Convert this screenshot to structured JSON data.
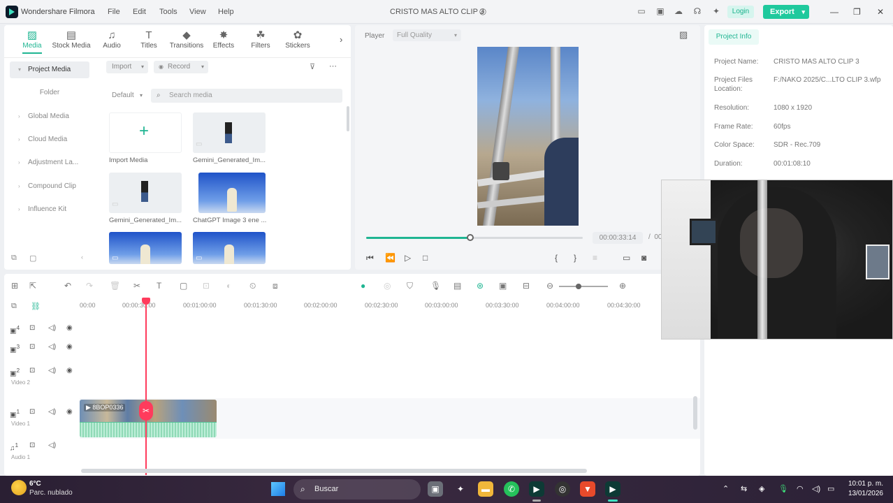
{
  "titlebar": {
    "app_name": "Wondershare Filmora",
    "menu": [
      "File",
      "Edit",
      "Tools",
      "View",
      "Help"
    ],
    "project_name": "CRISTO MAS ALTO CLIP 3",
    "login_label": "Login",
    "export_label": "Export"
  },
  "media_tabs": [
    {
      "label": "Media",
      "icon": "media-icon"
    },
    {
      "label": "Stock Media",
      "icon": "stock-media-icon"
    },
    {
      "label": "Audio",
      "icon": "music-note-icon"
    },
    {
      "label": "Titles",
      "icon": "text-icon"
    },
    {
      "label": "Transitions",
      "icon": "transitions-icon"
    },
    {
      "label": "Effects",
      "icon": "effects-icon"
    },
    {
      "label": "Filters",
      "icon": "filters-icon"
    },
    {
      "label": "Stickers",
      "icon": "stickers-icon"
    }
  ],
  "sidebar": {
    "items": [
      "Project Media",
      "Folder",
      "Global Media",
      "Cloud Media",
      "Adjustment La...",
      "Compound Clip",
      "Influence Kit"
    ]
  },
  "media_toolbar": {
    "import_label": "Import",
    "record_label": "Record",
    "sort_label": "Default",
    "search_placeholder": "Search media"
  },
  "media_items": [
    {
      "caption": "Import Media"
    },
    {
      "caption": "Gemini_Generated_Im..."
    },
    {
      "caption": "Gemini_Generated_Im..."
    },
    {
      "caption": "ChatGPT Image 3 ene ..."
    },
    {
      "caption": ""
    },
    {
      "caption": ""
    }
  ],
  "player": {
    "label": "Player",
    "quality": "Full Quality",
    "timecode": "00:00:33:14",
    "separator": "/",
    "total_visible": "00",
    "progress": 0.48
  },
  "project_info": {
    "tab_label": "Project Info",
    "rows": [
      {
        "key": "Project Name:",
        "value": "CRISTO MAS ALTO CLIP 3"
      },
      {
        "key": "Project Files Location:",
        "value": "F:/NAKO 2025/C...LTO CLIP 3.wfp"
      },
      {
        "key": "Resolution:",
        "value": "1080 x 1920"
      },
      {
        "key": "Frame Rate:",
        "value": "60fps"
      },
      {
        "key": "Color Space:",
        "value": "SDR - Rec.709"
      },
      {
        "key": "Duration:",
        "value": "00:01:08:10"
      }
    ]
  },
  "timeline": {
    "ruler": [
      "00:00",
      "00:00:30:00",
      "00:01:00:00",
      "00:01:30:00",
      "00:02:00:00",
      "00:02:30:00",
      "00:03:00:00",
      "00:03:30:00",
      "00:04:00:00",
      "00:04:30:00"
    ],
    "tracks": [
      {
        "num": "4",
        "name": ""
      },
      {
        "num": "3",
        "name": ""
      },
      {
        "num": "2",
        "name": "Video 2"
      },
      {
        "num": "1",
        "name": "Video 1"
      },
      {
        "num": "1",
        "name": "Audio 1"
      }
    ],
    "clip_label": "8BOP0336"
  },
  "taskbar": {
    "temperature": "6°C",
    "weather": "Parc. nublado",
    "search_label": "Buscar",
    "time": "10:01 p. m.",
    "date": "13/01/2026"
  },
  "colors": {
    "accent": "#1fb592",
    "export": "#1fc99d",
    "playhead": "#ff3b5c"
  }
}
